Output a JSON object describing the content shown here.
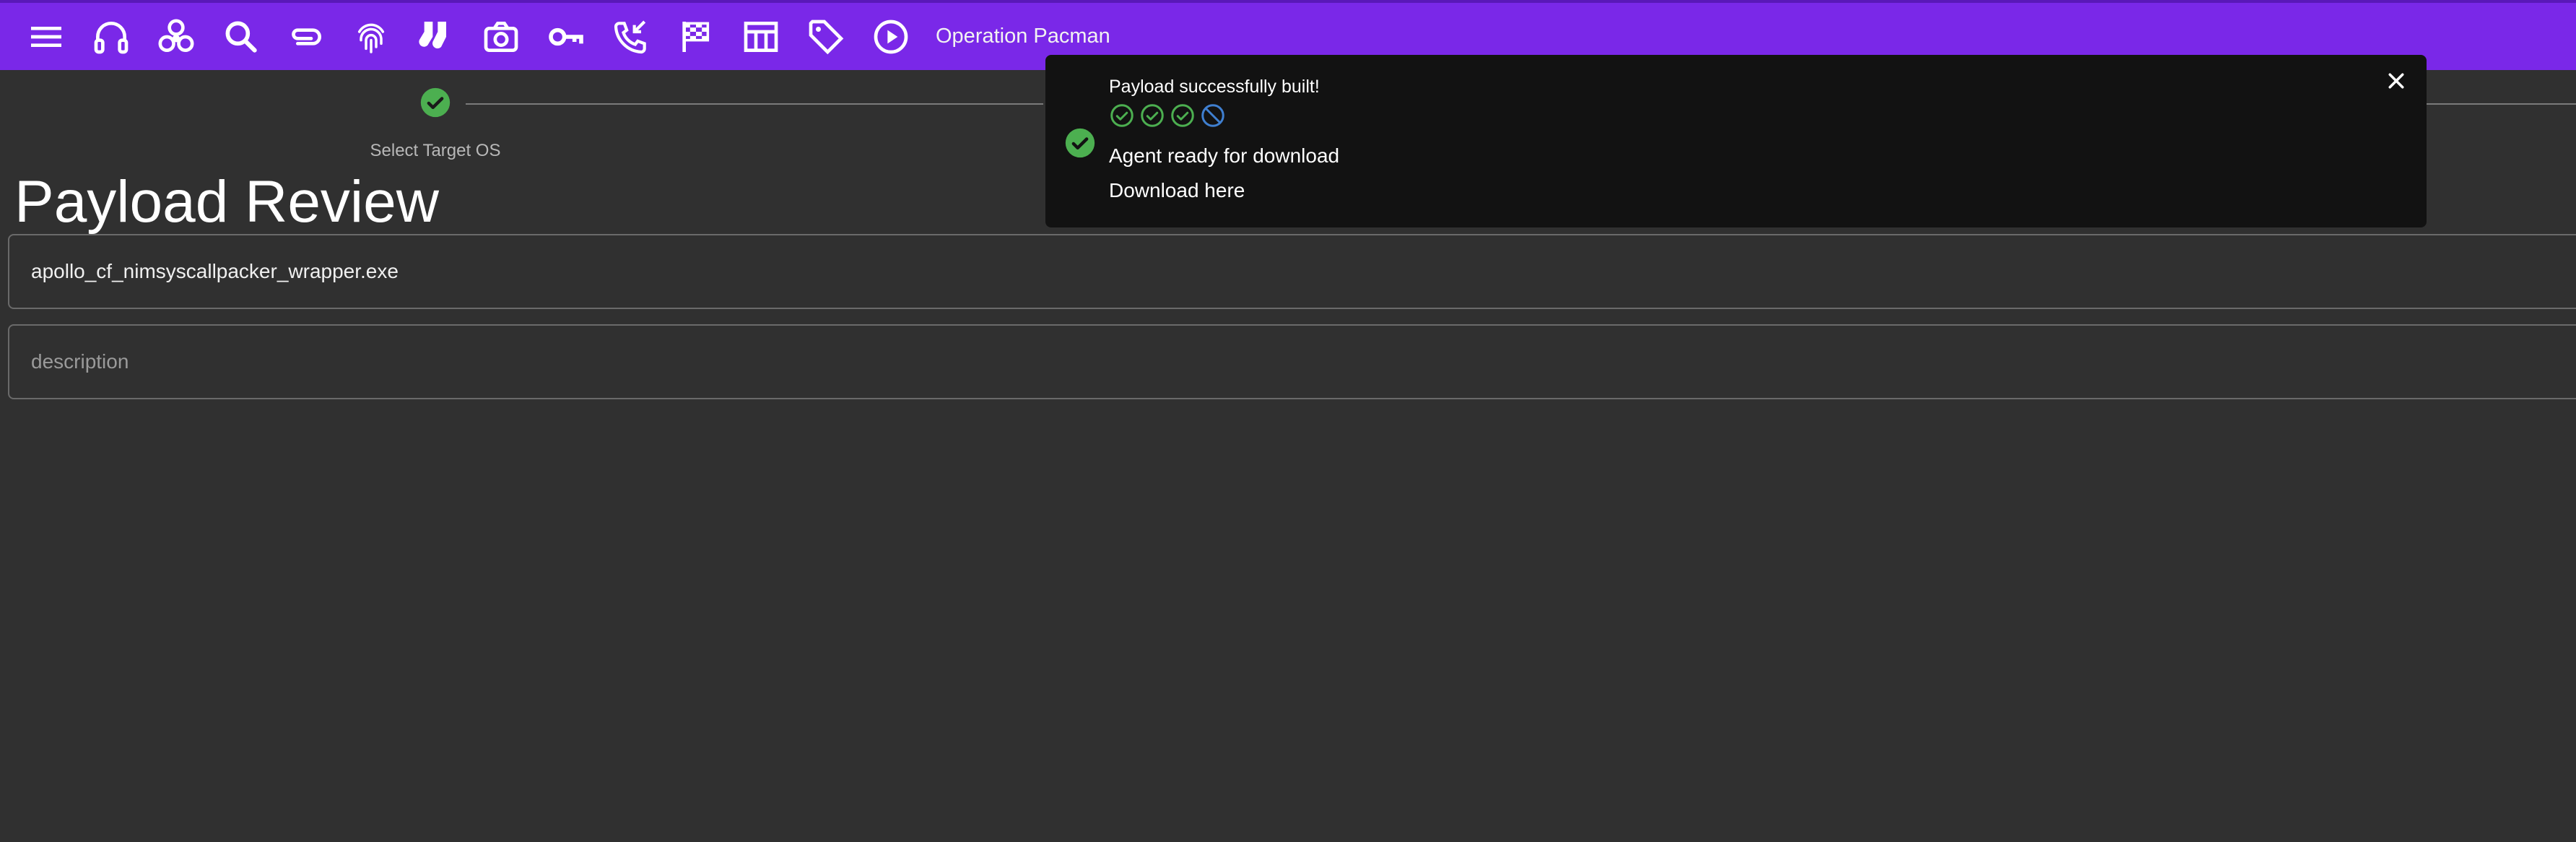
{
  "app": {
    "operation_name": "Operation Pacman",
    "icons": [
      "menu-icon",
      "headphones-icon",
      "biohazard-icon",
      "search-icon",
      "paperclip-icon",
      "fingerprint-icon",
      "socks-icon",
      "camera-icon",
      "key-icon",
      "phone-callback-icon",
      "checkered-flag-icon",
      "table-icon",
      "tag-icon",
      "play-circle-icon"
    ]
  },
  "stepper": {
    "step1_label": "Select Target OS"
  },
  "page": {
    "title": "Payload Review",
    "filename_value": "apollo_cf_nimsyscallpacker_wrapper.exe",
    "description_placeholder": "description"
  },
  "toast": {
    "title": "Payload successfully built!",
    "message": "Agent ready for download",
    "link_text": "Download here",
    "status_icons": [
      "check-circle-icon",
      "check-circle-icon",
      "check-circle-icon",
      "blocked-circle-icon"
    ]
  },
  "colors": {
    "topbar": "#7a28e8",
    "background": "#303030",
    "success": "#4caf50",
    "blocked": "#3f7fd0"
  }
}
